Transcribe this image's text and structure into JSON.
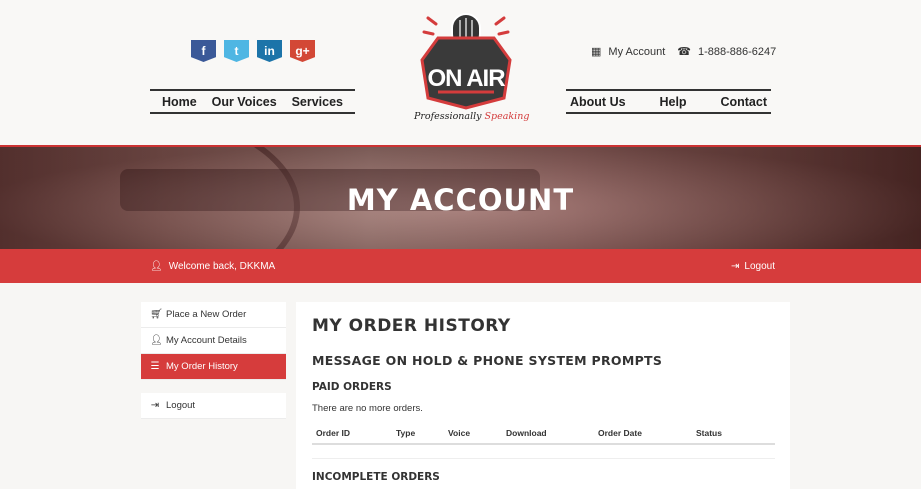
{
  "brand": {
    "logo_text": "ON AIR",
    "tagline_main": "Professionally ",
    "tagline_accent": "Speaking"
  },
  "social": [
    {
      "label": "f",
      "icon": "facebook-icon",
      "color": "#3b5998"
    },
    {
      "label": "t",
      "icon": "twitter-icon",
      "color": "#4fb6e3"
    },
    {
      "label": "in",
      "icon": "linkedin-icon",
      "color": "#1c74a9"
    },
    {
      "label": "g+",
      "icon": "google-plus-icon",
      "color": "#d34836"
    }
  ],
  "topbar": {
    "account_label": "My Account",
    "phone": "1-888-886-6247"
  },
  "nav_left": [
    "Home",
    "Our Voices",
    "Services"
  ],
  "nav_right": [
    "About Us",
    "Help",
    "Contact"
  ],
  "banner": {
    "title": "MY ACCOUNT"
  },
  "welcome_bar": {
    "welcome": "Welcome back, DKKMA",
    "logout": "Logout"
  },
  "sidebar": {
    "items": [
      {
        "label": "Place a New Order",
        "icon": "cart-icon"
      },
      {
        "label": "My Account Details",
        "icon": "user-icon"
      },
      {
        "label": "My Order History",
        "icon": "list-icon",
        "active": true
      }
    ],
    "logout": "Logout"
  },
  "main": {
    "title": "MY ORDER HISTORY",
    "section": "MESSAGE ON HOLD & PHONE SYSTEM PROMPTS",
    "paid_heading": "PAID ORDERS",
    "paid_empty": "There are no more orders.",
    "columns": [
      "Order ID",
      "Type",
      "Voice",
      "Download",
      "Order Date",
      "Status"
    ],
    "incomplete_heading": "INCOMPLETE ORDERS"
  },
  "colors": {
    "accent": "#d63c3c",
    "text": "#333333"
  }
}
